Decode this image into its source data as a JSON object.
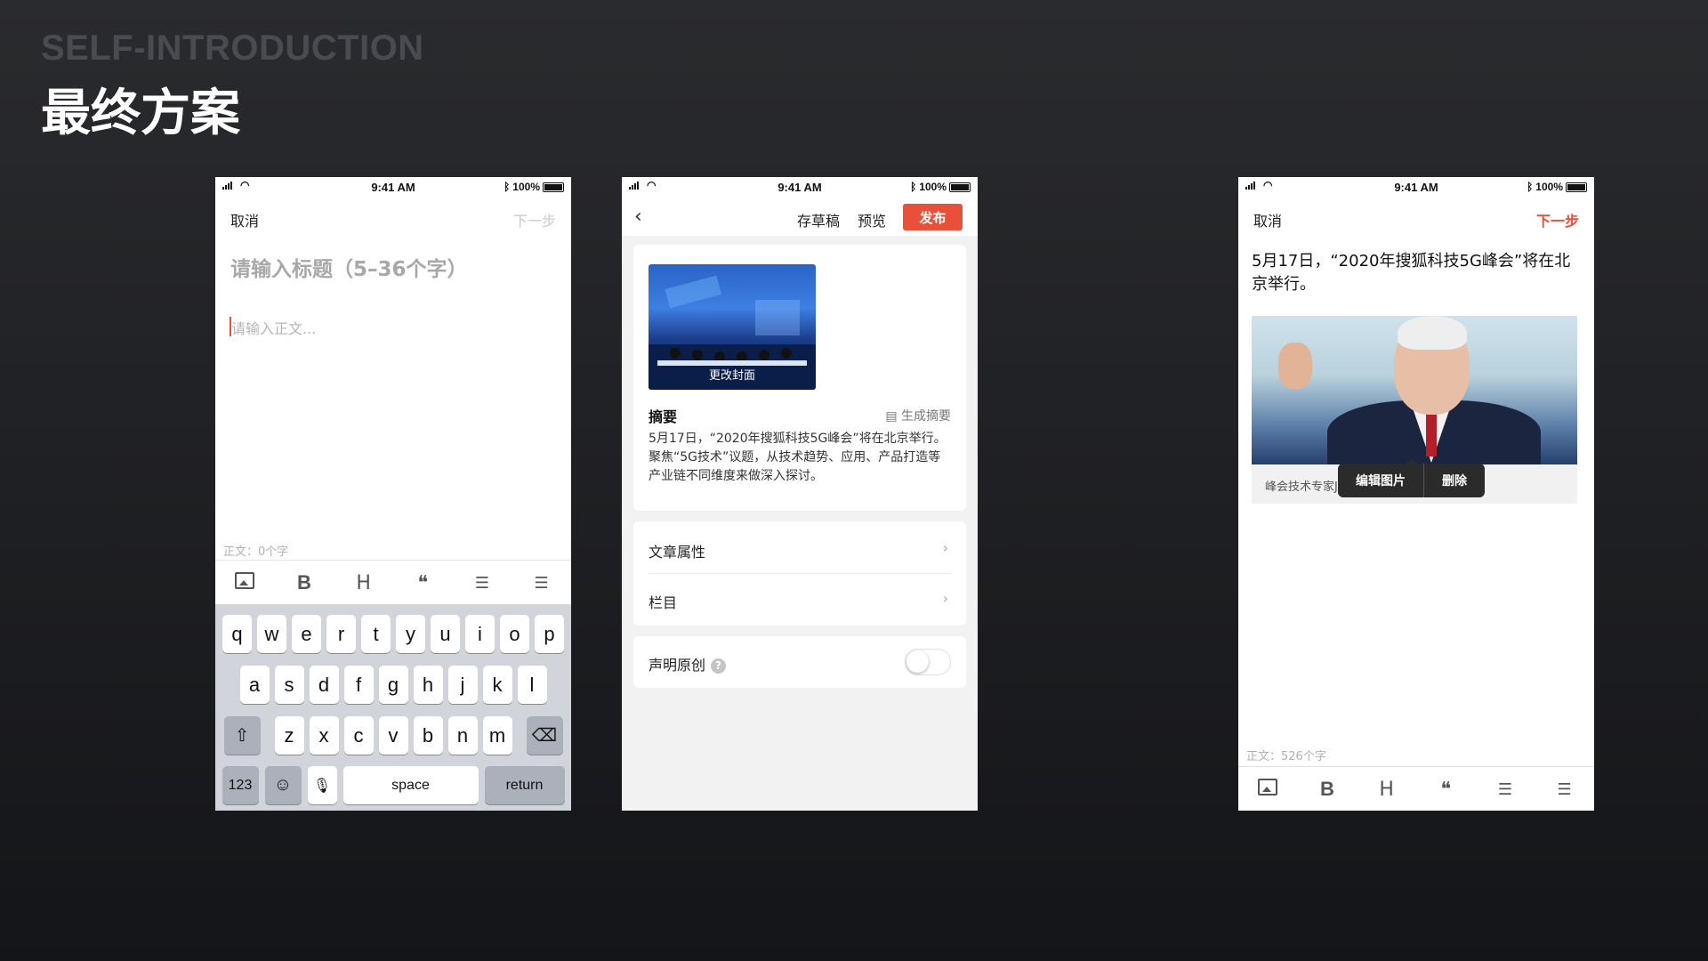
{
  "slide": {
    "title_en": "SELF-INTRODUCTION",
    "title_cn": "最终方案"
  },
  "status_bar": {
    "time": "9:41 AM",
    "battery": "100%",
    "bluetooth": "bluetooth-icon",
    "wifi": "wifi-icon"
  },
  "editor": {
    "cancel": "取消",
    "next": "下一步",
    "title_placeholder": "请输入标题（5–36个字）",
    "body_placeholder": "请输入正文...",
    "word_count": "正文：0个字",
    "toolbar": {
      "bold": "B",
      "heading": "H",
      "quote": "❝",
      "bullets": "☰",
      "numbers": "☰"
    }
  },
  "keyboard": {
    "row1": [
      "q",
      "w",
      "e",
      "r",
      "t",
      "y",
      "u",
      "i",
      "o",
      "p"
    ],
    "row2": [
      "a",
      "s",
      "d",
      "f",
      "g",
      "h",
      "j",
      "k",
      "l"
    ],
    "row3": [
      "z",
      "x",
      "c",
      "v",
      "b",
      "n",
      "m"
    ],
    "numbers": "123",
    "space": "space",
    "return": "return",
    "shift": "⇧",
    "delete": "⌫",
    "emoji": "☺",
    "mic": "🎙"
  },
  "publish": {
    "back": "‹",
    "save_draft": "存草稿",
    "preview": "预览",
    "publish": "发布",
    "change_cover": "更改封面",
    "summary_title": "摘要",
    "generate_summary": "生成摘要",
    "summary_text": "5月17日，“2020年搜狐科技5G峰会”将在北京举行。聚焦“5G技术”议题，从技术趋势、应用、产品打造等产业链不同维度来做深入探讨。",
    "article_props": "文章属性",
    "column": "栏目",
    "original_claim": "声明原创",
    "help": "?",
    "chevron": "›"
  },
  "article": {
    "cancel": "取消",
    "next": "下一步",
    "text": "5月17日，“2020年搜狐科技5G峰会”将在北京举行。",
    "caption": "峰会技术专家Jim",
    "edit_image": "编辑图片",
    "delete": "删除",
    "word_count": "正文：526个字"
  },
  "colors": {
    "accent": "#e8503a"
  }
}
